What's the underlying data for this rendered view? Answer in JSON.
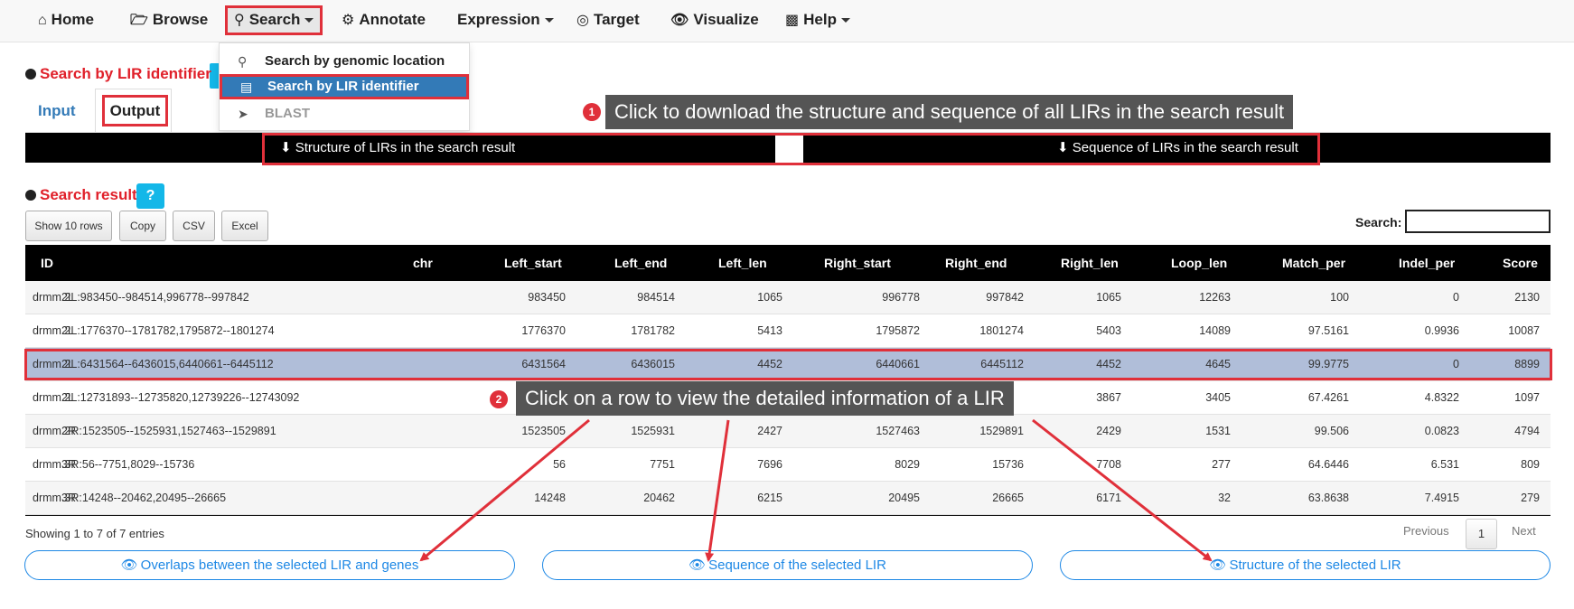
{
  "nav": {
    "home": "Home",
    "browse": "Browse",
    "search": "Search",
    "annotate": "Annotate",
    "expression": "Expression",
    "target": "Target",
    "visualize": "Visualize",
    "help": "Help"
  },
  "dropdown": {
    "items": [
      "Search by genomic location",
      "Search by LIR identifier",
      "BLAST"
    ]
  },
  "page_title": "Search by LIR identifier",
  "tabs": {
    "input": "Input",
    "output": "Output"
  },
  "callouts": {
    "one_num": "1",
    "one": "Click to download the structure and sequence of all LIRs in the search result",
    "two_num": "2",
    "two": "Click on a row to view the detailed information of a LIR"
  },
  "download": {
    "structure": "Structure of LIRs in the search result",
    "sequence": "Sequence of LIRs in the search result"
  },
  "result_title": "Search result",
  "help_label": "?",
  "toolbar": {
    "show": "Show 10 rows",
    "copy": "Copy",
    "csv": "CSV",
    "excel": "Excel",
    "search_label": "Search:",
    "search_value": ""
  },
  "table": {
    "columns": [
      "ID",
      "chr",
      "Left_start",
      "Left_end",
      "Left_len",
      "Right_start",
      "Right_end",
      "Right_len",
      "Loop_len",
      "Match_per",
      "Indel_per",
      "Score"
    ],
    "rows": [
      [
        "drmm.2L:983450--984514,996778--997842",
        "2L",
        "983450",
        "984514",
        "1065",
        "996778",
        "997842",
        "1065",
        "12263",
        "100",
        "0",
        "2130"
      ],
      [
        "drmm.2L:1776370--1781782,1795872--1801274",
        "2L",
        "1776370",
        "1781782",
        "5413",
        "1795872",
        "1801274",
        "5403",
        "14089",
        "97.5161",
        "0.9936",
        "10087"
      ],
      [
        "drmm.2L:6431564--6436015,6440661--6445112",
        "2L",
        "6431564",
        "6436015",
        "4452",
        "6440661",
        "6445112",
        "4452",
        "4645",
        "99.9775",
        "0",
        "8899"
      ],
      [
        "drmm.2L:12731893--12735820,12739226--12743092",
        "2L",
        "",
        "",
        "",
        "",
        "",
        "3867",
        "3405",
        "67.4261",
        "4.8322",
        "1097"
      ],
      [
        "drmm.2R:1523505--1525931,1527463--1529891",
        "2R",
        "1523505",
        "1525931",
        "2427",
        "1527463",
        "1529891",
        "2429",
        "1531",
        "99.506",
        "0.0823",
        "4794"
      ],
      [
        "drmm.3R:56--7751,8029--15736",
        "3R",
        "56",
        "7751",
        "7696",
        "8029",
        "15736",
        "7708",
        "277",
        "64.6446",
        "6.531",
        "809"
      ],
      [
        "drmm.3R:14248--20462,20495--26665",
        "3R",
        "14248",
        "20462",
        "6215",
        "20495",
        "26665",
        "6171",
        "32",
        "63.8638",
        "7.4915",
        "279"
      ]
    ]
  },
  "info": "Showing 1 to 7 of 7 entries",
  "pagination": {
    "previous": "Previous",
    "current": "1",
    "next": "Next"
  },
  "actions": {
    "overlaps": "Overlaps between the selected LIR and genes",
    "sequence": "Sequence of the selected LIR",
    "structure": "Structure of the selected LIR"
  },
  "colors": {
    "accent_red": "#e0303a",
    "link_blue": "#337ab7",
    "action_blue": "#1e88e5",
    "selected_row": "#b0bed9",
    "help_cyan": "#13b7e8"
  }
}
